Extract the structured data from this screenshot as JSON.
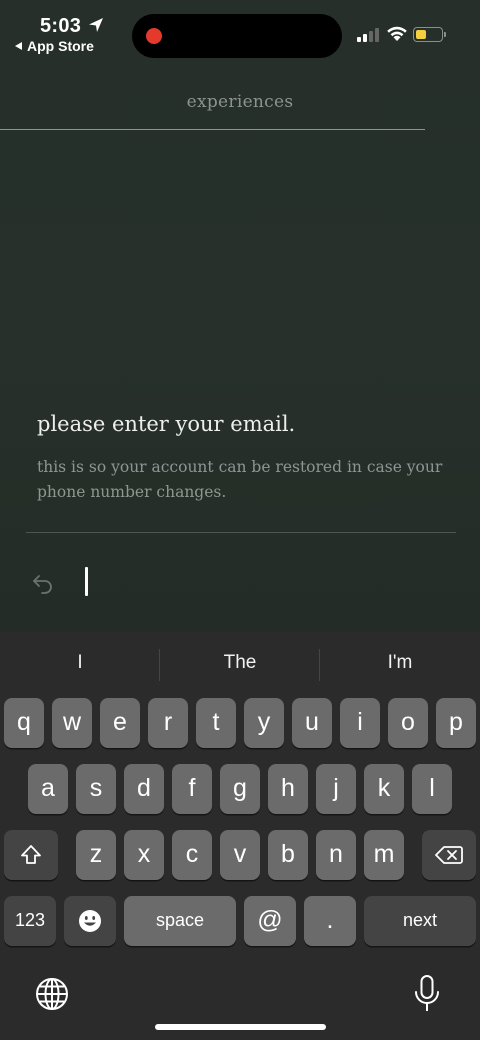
{
  "status_bar": {
    "time": "5:03",
    "back_label": "App Store",
    "recording_color": "#e33a2c",
    "battery_color": "#f4d03f"
  },
  "header": {
    "title": "experiences"
  },
  "prompt": {
    "title": "please enter your email.",
    "subtitle": "this is so your account can be restored in case your phone number changes."
  },
  "input": {
    "value": "",
    "placeholder": ""
  },
  "keyboard": {
    "suggestions": [
      "I",
      "The",
      "I'm"
    ],
    "row1": [
      "q",
      "w",
      "e",
      "r",
      "t",
      "y",
      "u",
      "i",
      "o",
      "p"
    ],
    "row2": [
      "a",
      "s",
      "d",
      "f",
      "g",
      "h",
      "j",
      "k",
      "l"
    ],
    "row3": [
      "z",
      "x",
      "c",
      "v",
      "b",
      "n",
      "m"
    ],
    "numbers_key": "123",
    "space_key": "space",
    "at_key": "@",
    "dot_key": ".",
    "return_key": "next",
    "icons": [
      "shift-icon",
      "backspace-icon",
      "emoji-icon",
      "globe-icon",
      "microphone-icon"
    ]
  }
}
